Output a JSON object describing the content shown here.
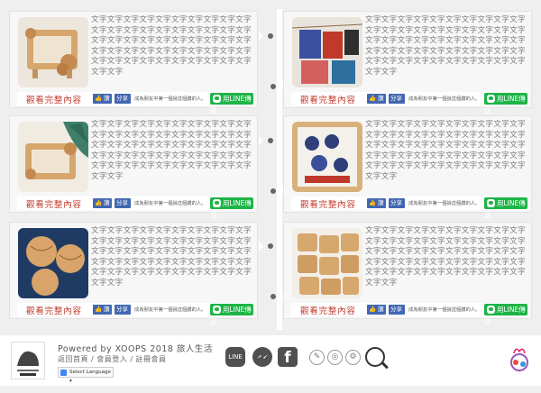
{
  "cards": [
    {
      "text": "文字文字文字文字文字文字文字文字文字文字文字文字文字文字文字文字文字文字文字文字文字文字文字文字文字文字文字文字文字文字文字文字文字文字文字文字文字文字文字文字文字文字文字文字文字文字文字文字文字文字文字文字",
      "more": "觀看完整內容",
      "like": "讚",
      "share": "分享",
      "note": "成為朋友中第一個說這個讚的人。",
      "line": "用LINE傳送",
      "thumb": "wooden-frame-flowers"
    },
    {
      "text": "文字文字文字文字文字文字文字文字文字文字文字文字文字文字文字文字文字文字文字文字文字文字文字文字文字文字文字文字文字文字文字文字文字文字文字文字文字文字文字文字文字文字文字文字文字文字文字文字文字文字文字文字",
      "more": "觀看完整內容",
      "like": "讚",
      "share": "分享",
      "note": "成為朋友中第一個說這個讚的人。",
      "line": "用LINE傳送",
      "thumb": "photo-cards-on-wall"
    },
    {
      "text": "文字文字文字文字文字文字文字文字文字文字文字文字文字文字文字文字文字文字文字文字文字文字文字文字文字文字文字文字文字文字文字文字文字文字文字文字文字文字文字文字文字文字文字文字文字文字文字文字文字文字文字文字",
      "more": "觀看完整內容",
      "like": "讚",
      "share": "分享",
      "note": "成為朋友中第一個說這個讚的人。",
      "line": "用LINE傳送",
      "thumb": "wooden-frame-leaves"
    },
    {
      "text": "文字文字文字文字文字文字文字文字文字文字文字文字文字文字文字文字文字文字文字文字文字文字文字文字文字文字文字文字文字文字文字文字文字文字文字文字文字文字文字文字文字文字文字文字文字文字文字文字文字文字文字文字",
      "more": "觀看完整內容",
      "like": "讚",
      "share": "分享",
      "note": "成為朋友中第一個說這個讚的人。",
      "line": "用LINE傳送",
      "thumb": "baseball-team-frame"
    },
    {
      "text": "文字文字文字文字文字文字文字文字文字文字文字文字文字文字文字文字文字文字文字文字文字文字文字文字文字文字文字文字文字文字文字文字文字文字文字文字文字文字文字文字文字文字文字文字文字文字文字文字文字文字文字文字",
      "more": "觀看完整內容",
      "like": "讚",
      "share": "分享",
      "note": "成為朋友中第一個說這個讚的人。",
      "line": "用LINE傳送",
      "thumb": "wooden-baseballs"
    },
    {
      "text": "文字文字文字文字文字文字文字文字文字文字文字文字文字文字文字文字文字文字文字文字文字文字文字文字文字文字文字文字文字文字文字文字文字文字文字文字文字文字文字文字文字文字文字文字文字文字文字文字文字文字文字文字",
      "more": "觀看完整內容",
      "like": "讚",
      "share": "分享",
      "note": "成為朋友中第一個說這個讚的人。",
      "line": "用LINE傳送",
      "thumb": "wooden-keychains"
    }
  ],
  "footer": {
    "powered": "Powered by XOOPS  2018 旅人生活",
    "links": "返回首頁 / 會員登入 / 註冊會員",
    "language": "Select Language",
    "line_icon": "LINE"
  },
  "colors": {
    "more_link": "#c0392b",
    "line_green": "#1db446",
    "fb_blue": "#4267b2"
  }
}
